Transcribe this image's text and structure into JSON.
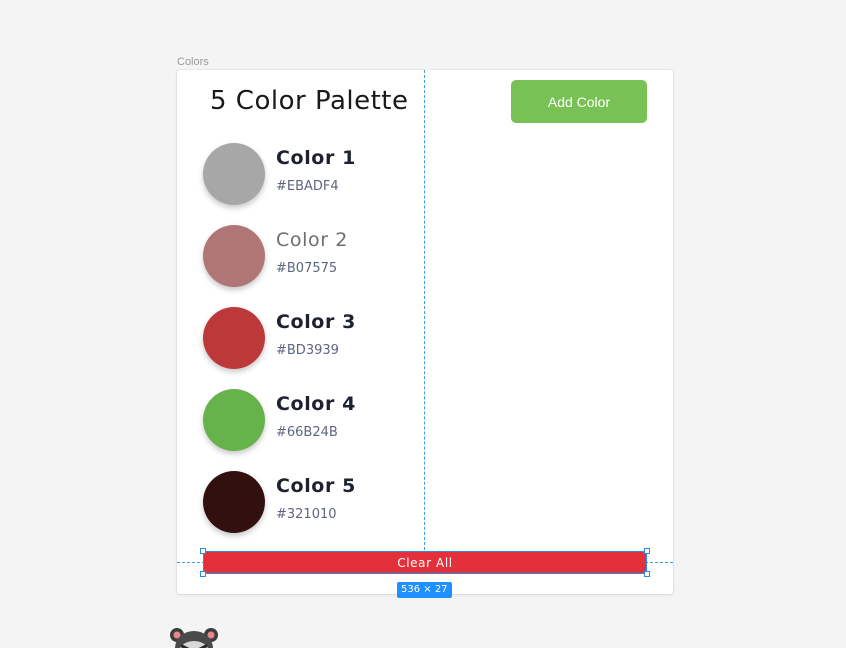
{
  "frame": {
    "label": "Colors"
  },
  "header": {
    "title": "5 Color Palette",
    "add_button_label": "Add Color"
  },
  "colors": [
    {
      "name": "Color 1",
      "hex_label": "#EBADF4",
      "swatch": "#a7a7a7"
    },
    {
      "name": "Color 2",
      "hex_label": "#B07575",
      "swatch": "#b07575"
    },
    {
      "name": "Color 3",
      "hex_label": "#BD3939",
      "swatch": "#bd3939"
    },
    {
      "name": "Color 4",
      "hex_label": "#66B24B",
      "swatch": "#66b24b"
    },
    {
      "name": "Color 5",
      "hex_label": "#321010",
      "swatch": "#321010"
    }
  ],
  "footer": {
    "clear_button_label": "Clear All",
    "selection_size": "536 × 27"
  },
  "colors_ui": {
    "background": "#f4f4f4",
    "frame": "#ffffff",
    "add_button": "#78c154",
    "clear_button": "#e3303a",
    "selection": "#1e90ff"
  },
  "icons": {
    "mascot": "raccoon-mascot-icon"
  }
}
